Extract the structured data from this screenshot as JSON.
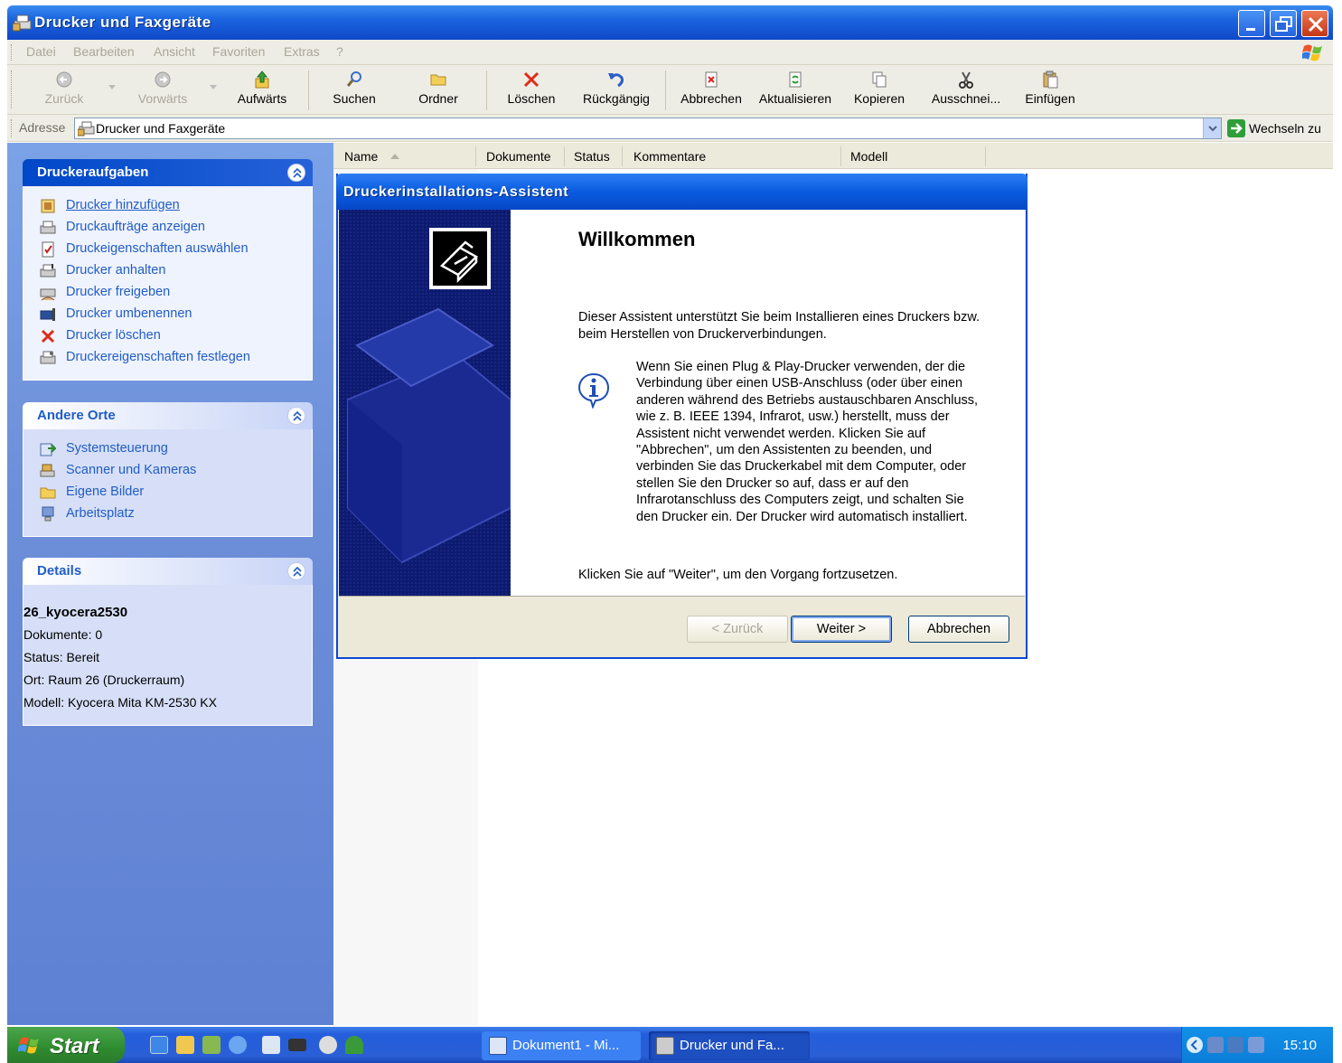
{
  "window": {
    "title": "Drucker und Faxgeräte"
  },
  "menu": [
    "Datei",
    "Bearbeiten",
    "Ansicht",
    "Favoriten",
    "Extras",
    "?"
  ],
  "toolbar": {
    "back": "Zurück",
    "forward": "Vorwärts",
    "up": "Aufwärts",
    "search": "Suchen",
    "folders": "Ordner",
    "delete": "Löschen",
    "undo": "Rückgängig",
    "cancel": "Abbrechen",
    "refresh": "Aktualisieren",
    "copy": "Kopieren",
    "cut": "Ausschnei...",
    "paste": "Einfügen"
  },
  "address": {
    "label": "Adresse",
    "value": "Drucker und Faxgeräte",
    "go": "Wechseln zu"
  },
  "tasks": {
    "title": "Druckeraufgaben",
    "items": [
      "Drucker hinzufügen",
      "Druckaufträge anzeigen",
      "Druckeigenschaften auswählen",
      "Drucker anhalten",
      "Drucker freigeben",
      "Drucker umbenennen",
      "Drucker löschen",
      "Druckereigenschaften festlegen"
    ]
  },
  "places": {
    "title": "Andere Orte",
    "items": [
      "Systemsteuerung",
      "Scanner und Kameras",
      "Eigene Bilder",
      "Arbeitsplatz"
    ]
  },
  "details": {
    "title": "Details",
    "name": "26_kyocera2530",
    "docs": "Dokumente: 0",
    "status": "Status: Bereit",
    "location": "Ort: Raum 26 (Druckerraum)",
    "model": "Modell: Kyocera Mita KM-2530 KX"
  },
  "columns": [
    "Name",
    "Dokumente",
    "Status",
    "Kommentare",
    "Modell"
  ],
  "wizard": {
    "title": "Druckerinstallations-Assistent",
    "heading": "Willkommen",
    "intro": "Dieser Assistent unterstützt Sie beim Installieren eines Druckers bzw. beim Herstellen von Druckerverbindungen.",
    "info": "Wenn Sie einen Plug & Play-Drucker verwenden, der die Verbindung über einen USB-Anschluss (oder über einen anderen während des Betriebs austauschbaren Anschluss, wie z. B. IEEE 1394, Infrarot, usw.) herstellt, muss der Assistent nicht verwendet werden. Klicken Sie auf \"Abbrechen\", um den Assistenten zu beenden, und verbinden Sie das Druckerkabel mit dem Computer, oder stellen Sie den Drucker so auf, dass er auf den Infrarotanschluss des Computers zeigt, und schalten Sie den Drucker ein. Der Drucker wird automatisch installiert.",
    "continue": "Klicken Sie auf \"Weiter\", um den Vorgang fortzusetzen.",
    "back": "< Zurück",
    "next": "Weiter >",
    "cancel": "Abbrechen"
  },
  "taskbar": {
    "start": "Start",
    "tasks": [
      "Dokument1 - Mi...",
      "Drucker und Fa..."
    ],
    "clock": "15:10"
  },
  "colors": {
    "xp_blue": "#0a5ce0",
    "panel_link": "#215dc6",
    "start_green": "#3a9a3a"
  }
}
